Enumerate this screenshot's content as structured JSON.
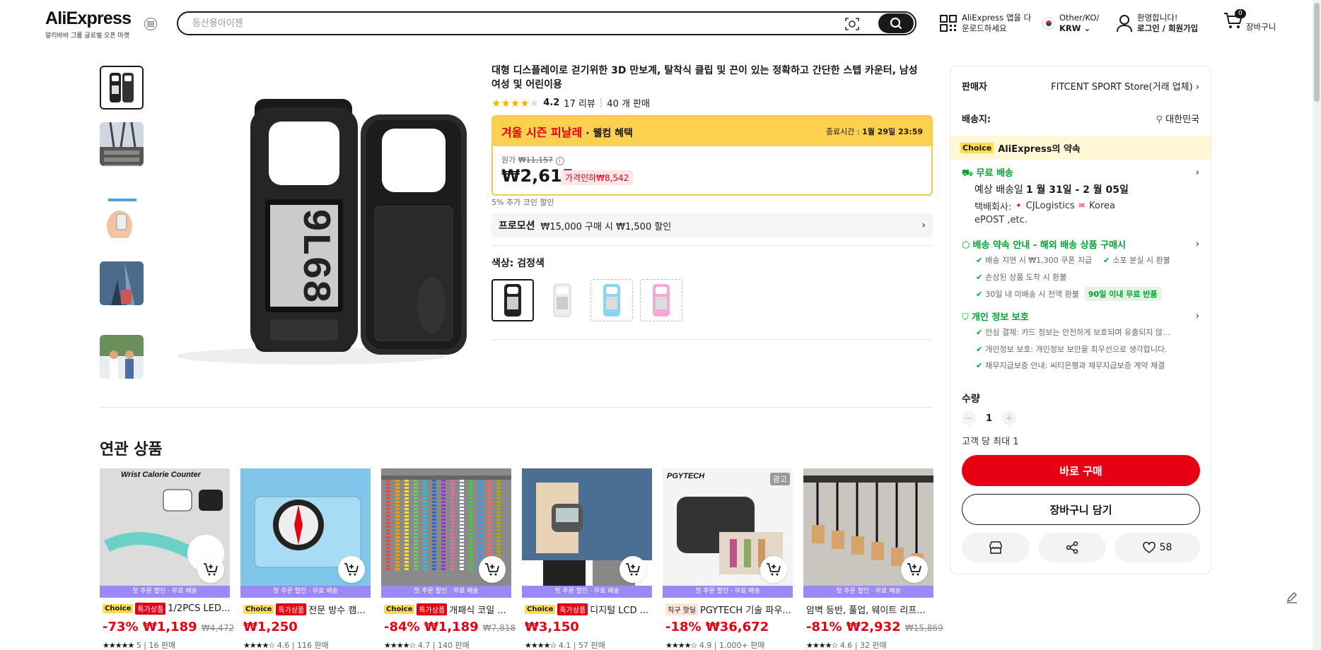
{
  "header": {
    "logo": "AliExpress",
    "logo_sub": "알리바바 그룹 글로벌 오픈 마켓",
    "search_placeholder": "등산용아이젠",
    "app_line1": "AliExpress 앱을 다",
    "app_line2": "운로드하세요",
    "locale_line1": "Other/KO/",
    "locale_line2": "KRW",
    "account_line1": "환영합니다!",
    "account_line2": "로그인 / 회원가입",
    "cart_count": "0",
    "cart_label": "장바구니"
  },
  "product": {
    "title": "대형 디스플레이로 걷기위한 3D 만보계, 탈착식 클립 및 끈이 있는 정확하고 간단한 스텝 카운터, 남성 여성 및 어린이용",
    "rating": "4.2",
    "reviews": "17 리뷰",
    "sold": "40 개 판매",
    "stars_filled": 4,
    "banner_title": "겨울 시즌 피날레",
    "banner_sub": "· 웰컴 혜택",
    "end_label": "종료시간 :",
    "end_time": "1월 29일 23:59",
    "orig_label": "원가",
    "orig_price": "₩11,157",
    "price": "₩2,615",
    "discount": "가격인하₩8,542",
    "coin": "5% 추가 코인 할인",
    "promo_label": "프로모션",
    "promo_text": "₩15,000 구매 시 ₩1,500 할인",
    "color_label": "색상: 검정색",
    "display_digits": "9L68"
  },
  "related": {
    "title": "연관 상품",
    "cards": [
      {
        "band": "첫 주문 할인 · 무료 배송",
        "tag1": "Choice",
        "tag2": "특가상품",
        "name": "1/2PCS LED...",
        "discount": "-73%",
        "price": "₩1,189",
        "orig": "₩4,472",
        "rating": "5",
        "sold": "16 판매",
        "img_text": "Wrist Calorie Counter",
        "ad": ""
      },
      {
        "band": "첫 주문 할인 · 무료 배송",
        "tag1": "Choice",
        "tag2": "특가상품",
        "name": "전문 방수 캠...",
        "discount": "",
        "price": "₩1,250",
        "orig": "",
        "rating": "4.6",
        "sold": "116 판매",
        "img_text": "",
        "ad": ""
      },
      {
        "band": "첫 주문 할인 · 무료 배송",
        "tag1": "Choice",
        "tag2": "특가상품",
        "name": "개패식 코일 ...",
        "discount": "-84%",
        "price": "₩1,189",
        "orig": "₩7,818",
        "rating": "4.7",
        "sold": "140 판매",
        "img_text": "",
        "ad": ""
      },
      {
        "band": "첫 주문 할인 · 무료 배송",
        "tag1": "Choice",
        "tag2": "특가상품",
        "name": "디지털 LCD ...",
        "discount": "",
        "price": "₩3,150",
        "orig": "",
        "rating": "4.1",
        "sold": "57 판매",
        "img_text": "",
        "ad": ""
      },
      {
        "band": "첫 주문 할인 · 무료 배송",
        "tag1": "직구 핫딜",
        "tag2": "",
        "name": "PGYTECH 기술 파우...",
        "discount": "-18%",
        "price": "₩36,672",
        "orig": "",
        "rating": "4.9",
        "sold": "1,000+ 판매",
        "img_text": "PGYTECH",
        "ad": "광고"
      },
      {
        "band": "첫 주문 할인 · 무료 배송",
        "tag1": "",
        "tag2": "",
        "name": "암벽 등반, 풀업, 웨이트 리프...",
        "discount": "-81%",
        "price": "₩2,932",
        "orig": "₩15,869",
        "rating": "4.6",
        "sold": "32 판매",
        "img_text": "",
        "ad": ""
      }
    ]
  },
  "panel": {
    "seller_label": "판매자",
    "seller_name": "FITCENT SPORT Store(거래 업체)",
    "ship_label": "배송지:",
    "ship_to": "대한민국",
    "choice_tag": "Choice",
    "choice_text": "AliExpress의 약속",
    "free_ship": "무료 배송",
    "eta_prefix": "예상 배송일",
    "eta": "1 월 31일 - 2 월 05일",
    "carrier_prefix": "택배회사:",
    "carrier1": "CJLogistics",
    "carrier2": "Korea",
    "carrier3": "ePOST ,etc.",
    "guarantee_title": "배송 약속 안내 - 해외 배송 상품 구매시",
    "g1": "배송 지연 시 ₩1,300 쿠폰 지급",
    "g2": "소포 분실 시 환불",
    "g3": "손상된 상품 도착 시 환불",
    "g4": "30일 내 미배송 시 전액 환불",
    "g4_badge": "90일 이내 무료 반품",
    "privacy_title": "개인 정보 보호",
    "p1": "안심 결제: 카드 정보는 안전하게 보호되며 유출되지 않...",
    "p2": "개인정보 보호: 개인정보 보안을 최우선으로 생각합니다.",
    "p3": "채무지급보증 안내: 씨티은행과 채무지급보증 계약 체결",
    "qty_label": "수량",
    "qty": "1",
    "max_label": "고객 당 최대 1",
    "buy_now": "바로 구매",
    "add_cart": "장바구니 담기",
    "wish_count": "58"
  },
  "colors": {
    "brand_red": "#e50113",
    "choice_yellow": "#fedb4f",
    "green": "#00a32e",
    "band_purple": "#9b89f7"
  }
}
